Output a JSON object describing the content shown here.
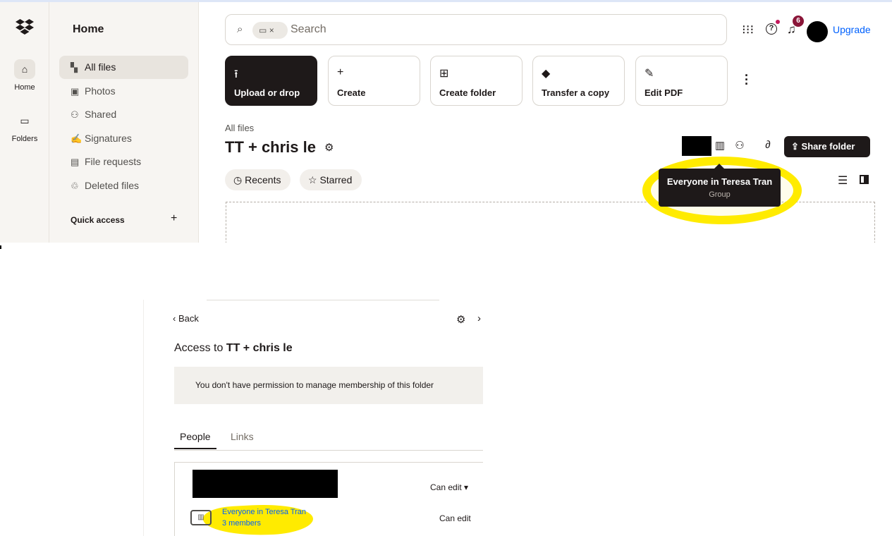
{
  "top": {
    "rail": {
      "home_label": "Home",
      "folders_label": "Folders",
      "logo_icon": "dropbox-logo-icon"
    },
    "sidebar": {
      "title": "Home",
      "items": [
        {
          "label": "All files",
          "icon": "all-files-icon",
          "active": true
        },
        {
          "label": "Photos",
          "icon": "photos-icon"
        },
        {
          "label": "Shared",
          "icon": "shared-icon"
        },
        {
          "label": "Signatures",
          "icon": "signatures-icon"
        },
        {
          "label": "File requests",
          "icon": "file-requests-icon"
        },
        {
          "label": "Deleted files",
          "icon": "trash-icon"
        }
      ],
      "quick_access": "Quick access",
      "quick_add": "+"
    },
    "search": {
      "placeholder": "Search",
      "chip_close": "×"
    },
    "header": {
      "notification_count": "6",
      "upgrade": "Upgrade"
    },
    "actions": [
      {
        "label": "Upload or drop",
        "icon": "upload-icon",
        "glyph": "⭱"
      },
      {
        "label": "Create",
        "icon": "plus-icon",
        "glyph": "+"
      },
      {
        "label": "Create folder",
        "icon": "create-folder-icon",
        "glyph": "⊞"
      },
      {
        "label": "Transfer a copy",
        "icon": "transfer-icon",
        "glyph": "◆"
      },
      {
        "label": "Edit PDF",
        "icon": "edit-pdf-icon",
        "glyph": "✎"
      }
    ],
    "folder": {
      "breadcrumb": "All files",
      "title": "TT + chris le",
      "share_button": "Share folder"
    },
    "filters": {
      "recents": "Recents",
      "starred": "Starred"
    },
    "tooltip": {
      "title": "Everyone in Teresa Tran",
      "subtitle": "Group"
    },
    "colors": {
      "accent_blue": "#0061fe",
      "highlight_yellow": "#ffeb00",
      "dark": "#1e1919",
      "sidebar_bg": "#f7f5f2"
    }
  },
  "bottom": {
    "back_label": "Back",
    "access_prefix": "Access to ",
    "access_folder": "TT + chris le",
    "permission_notice": "You don't have permission to manage membership of this folder",
    "tabs": {
      "people": "People",
      "links": "Links"
    },
    "members": [
      {
        "name": "",
        "redacted": true,
        "permission": "Can edit ▾"
      },
      {
        "name": "Everyone in Teresa Tran",
        "count": "3 members",
        "permission": "Can edit"
      }
    ]
  }
}
